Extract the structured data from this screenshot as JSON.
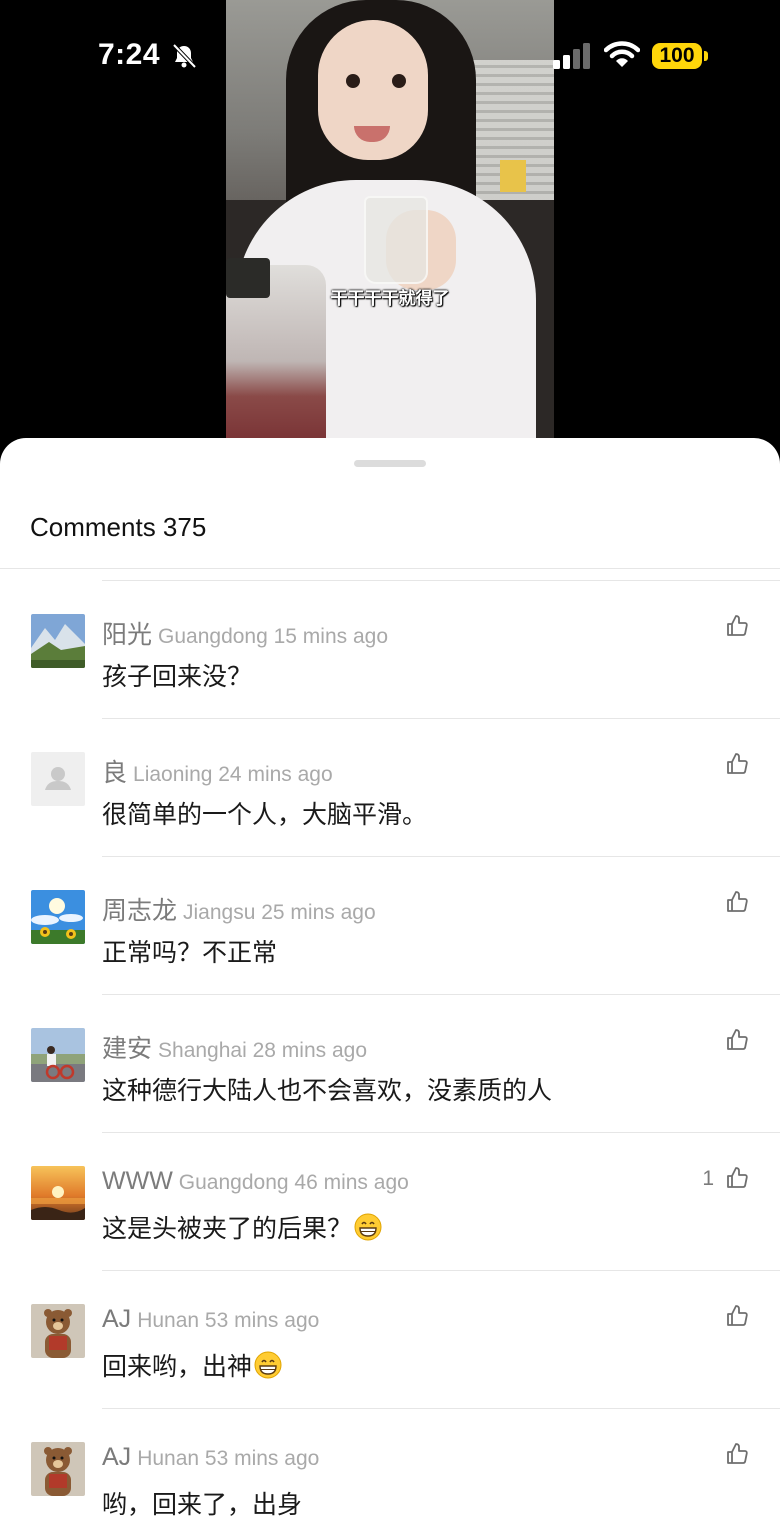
{
  "status_bar": {
    "time": "7:24",
    "battery": "100"
  },
  "video": {
    "subtitle": "干干干干就得了"
  },
  "sheet": {
    "title": "Comments 375"
  },
  "comments": [
    {
      "name": "阳光",
      "meta": "Guangdong 15 mins ago",
      "text": "孩子回来没？",
      "likes": "",
      "avatar": "mountain-landscape"
    },
    {
      "name": "良",
      "meta": "Liaoning 24 mins ago",
      "text": "很简单的一个人，大脑平滑。",
      "likes": "",
      "avatar": "default-user"
    },
    {
      "name": "周志龙",
      "meta": "Jiangsu 25 mins ago",
      "text": "正常吗？不正常",
      "likes": "",
      "avatar": "sunflower-sky"
    },
    {
      "name": "建安",
      "meta": "Shanghai 28 mins ago",
      "text": "这种德行大陆人也不会喜欢，没素质的人",
      "likes": "",
      "avatar": "cyclist-road"
    },
    {
      "name": "WWW",
      "meta": "Guangdong 46 mins ago",
      "text": "这是头被夹了的后果？",
      "likes": "1",
      "avatar": "sunset-sea",
      "emoji": "grin"
    },
    {
      "name": "AJ",
      "meta": "Hunan 53 mins ago",
      "text": "回来哟，出神",
      "likes": "",
      "avatar": "teddy-bear",
      "emoji": "grin"
    },
    {
      "name": "AJ",
      "meta": "Hunan 53 mins ago",
      "text": "哟，回来了，出身",
      "likes": "",
      "avatar": "teddy-bear"
    }
  ],
  "colors": {
    "battery": "#ffd60a",
    "meta_text": "#a9a9a9",
    "name_text": "#7b7b7b",
    "divider": "#e6e6e6"
  }
}
